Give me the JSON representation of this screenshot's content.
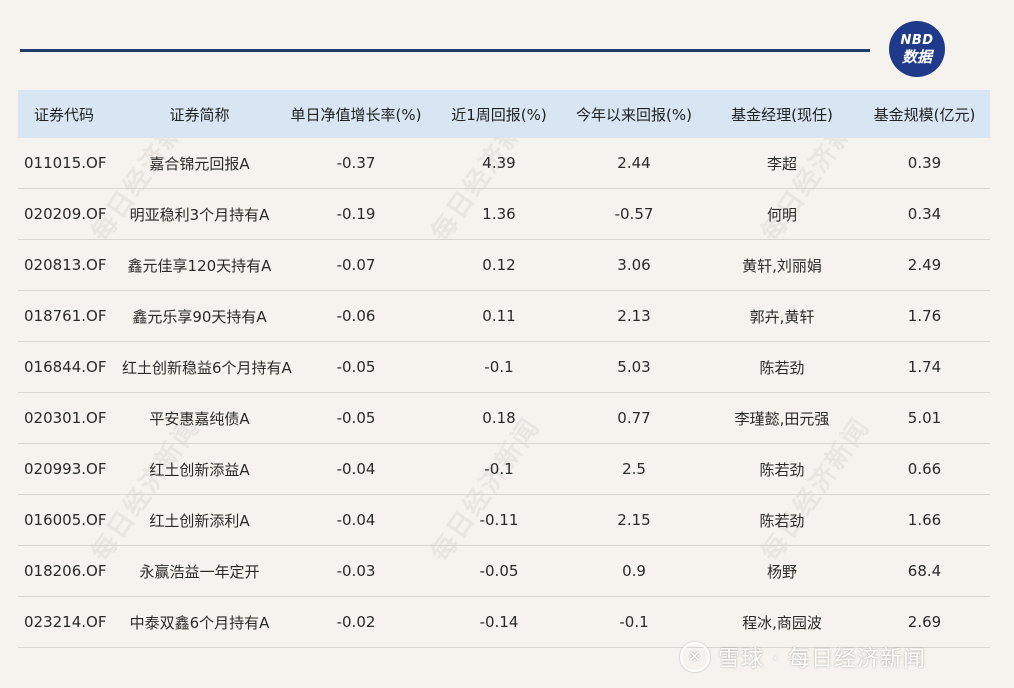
{
  "brand": {
    "logo_top": "NBD",
    "logo_bottom": "数据"
  },
  "table": {
    "headers": [
      "证券代码",
      "证券简称",
      "单日净值增长率(%)",
      "近1周回报(%)",
      "今年以来回报(%)",
      "基金经理(现任)",
      "基金规模(亿元)"
    ],
    "rows": [
      [
        "011015.OF",
        "嘉合锦元回报A",
        "-0.37",
        "4.39",
        "2.44",
        "李超",
        "0.39"
      ],
      [
        "020209.OF",
        "明亚稳利3个月持有A",
        "-0.19",
        "1.36",
        "-0.57",
        "何明",
        "0.34"
      ],
      [
        "020813.OF",
        "鑫元佳享120天持有A",
        "-0.07",
        "0.12",
        "3.06",
        "黄轩,刘丽娟",
        "2.49"
      ],
      [
        "018761.OF",
        "鑫元乐享90天持有A",
        "-0.06",
        "0.11",
        "2.13",
        "郭卉,黄轩",
        "1.76"
      ],
      [
        "016844.OF",
        "红土创新稳益6个月持有A",
        "-0.05",
        "-0.1",
        "5.03",
        "陈若劲",
        "1.74"
      ],
      [
        "020301.OF",
        "平安惠嘉纯债A",
        "-0.05",
        "0.18",
        "0.77",
        "李瑾懿,田元强",
        "5.01"
      ],
      [
        "020993.OF",
        "红土创新添益A",
        "-0.04",
        "-0.1",
        "2.5",
        "陈若劲",
        "0.66"
      ],
      [
        "016005.OF",
        "红土创新添利A",
        "-0.04",
        "-0.11",
        "2.15",
        "陈若劲",
        "1.66"
      ],
      [
        "018206.OF",
        "永赢浩益一年定开",
        "-0.03",
        "-0.05",
        "0.9",
        "杨野",
        "68.4"
      ],
      [
        "023214.OF",
        "中泰双鑫6个月持有A",
        "-0.02",
        "-0.14",
        "-0.1",
        "程冰,商园波",
        "2.69"
      ]
    ]
  },
  "watermark_text": "每日经济新闻",
  "footer": {
    "symbol": "※",
    "text": "雪球 · 每日经济新闻"
  },
  "colors": {
    "accent": "#1f3a8a",
    "header_bg": "#d7e6f2",
    "background": "#f6f3ef"
  }
}
